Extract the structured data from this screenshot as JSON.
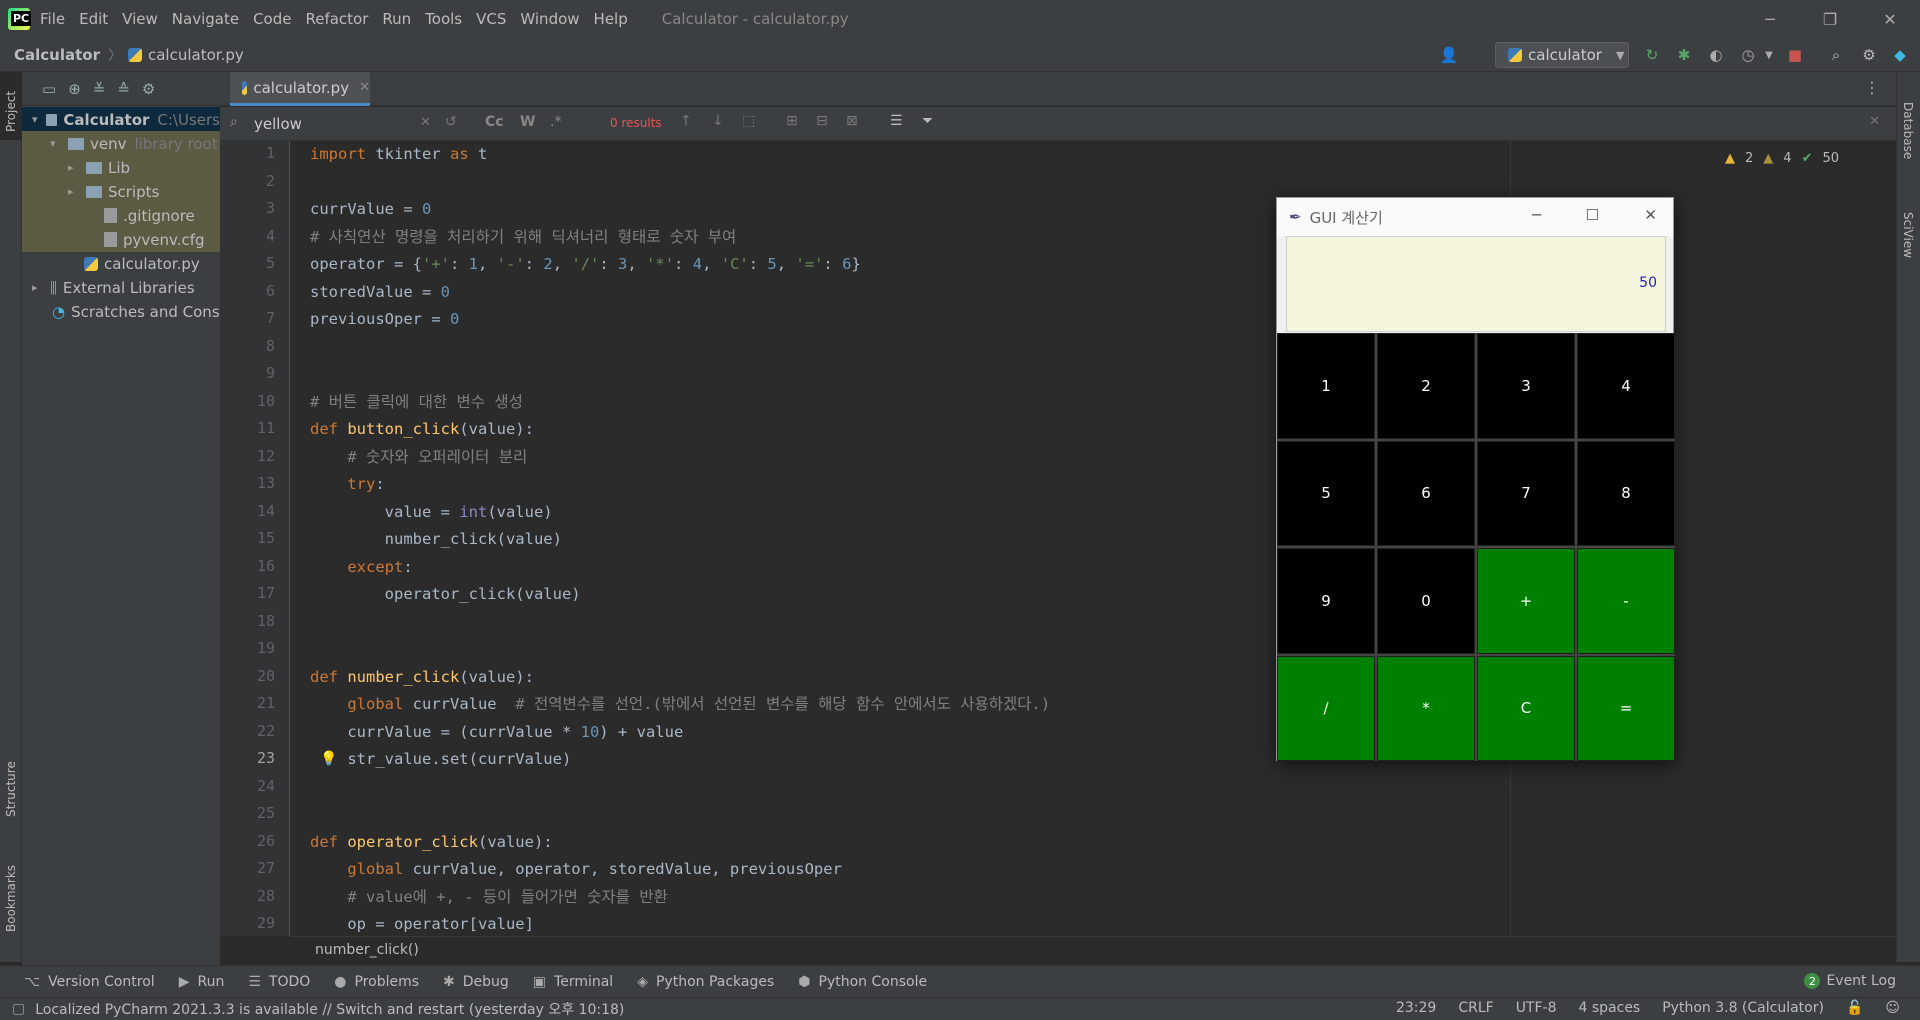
{
  "window": {
    "title": "Calculator - calculator.py",
    "menu": [
      "File",
      "Edit",
      "View",
      "Navigate",
      "Code",
      "Refactor",
      "Run",
      "Tools",
      "VCS",
      "Window",
      "Help"
    ]
  },
  "navbar": {
    "project": "Calculator",
    "file": "calculator.py",
    "run_config": "calculator"
  },
  "side_stripes": {
    "left_top": "Project",
    "left_structure": "Structure",
    "left_bookmarks": "Bookmarks",
    "right_database": "Database",
    "right_sciview": "SciView"
  },
  "project_tree": [
    {
      "label": "Calculator",
      "hint": "C:\\Users",
      "icon": "folder-icon",
      "arrow": "▾"
    },
    {
      "label": "venv",
      "hint": "library root",
      "icon": "folder-icon",
      "arrow": "▾"
    },
    {
      "label": "Lib",
      "hint": "",
      "icon": "folder-icon",
      "arrow": "▸"
    },
    {
      "label": "Scripts",
      "hint": "",
      "icon": "folder-icon",
      "arrow": "▸"
    },
    {
      "label": ".gitignore",
      "hint": "",
      "icon": "file-icon",
      "arrow": ""
    },
    {
      "label": "pyvenv.cfg",
      "hint": "",
      "icon": "file-icon",
      "arrow": ""
    },
    {
      "label": "calculator.py",
      "hint": "",
      "icon": "python-file-icon",
      "arrow": ""
    },
    {
      "label": "External Libraries",
      "hint": "",
      "icon": "library-icon",
      "arrow": "▸"
    },
    {
      "label": "Scratches and Consoles",
      "hint": "",
      "icon": "scratch-icon",
      "arrow": ""
    }
  ],
  "editor": {
    "tab": "calculator.py",
    "search_value": "yellow",
    "search_results": "0 results",
    "inspections": {
      "warnings": "2",
      "weak_warnings": "4",
      "ok": "50"
    },
    "breadcrumb": "number_click()",
    "current_line": "23"
  },
  "code_lines": [
    [
      {
        "t": "import ",
        "c": "kw"
      },
      {
        "t": "tkinter ",
        "c": ""
      },
      {
        "t": "as ",
        "c": "kw"
      },
      {
        "t": "t",
        "c": ""
      }
    ],
    [],
    [
      {
        "t": "currValue = ",
        "c": ""
      },
      {
        "t": "0",
        "c": "num"
      }
    ],
    [
      {
        "t": "# 사칙연산 명령을 처리하기 위해 딕셔너리 형태로 숫자 부여",
        "c": "cm"
      }
    ],
    [
      {
        "t": "operator = {",
        "c": ""
      },
      {
        "t": "'+'",
        "c": "str"
      },
      {
        "t": ": ",
        "c": ""
      },
      {
        "t": "1",
        "c": "num"
      },
      {
        "t": ", ",
        "c": ""
      },
      {
        "t": "'-'",
        "c": "str"
      },
      {
        "t": ": ",
        "c": ""
      },
      {
        "t": "2",
        "c": "num"
      },
      {
        "t": ", ",
        "c": ""
      },
      {
        "t": "'/'",
        "c": "str"
      },
      {
        "t": ": ",
        "c": ""
      },
      {
        "t": "3",
        "c": "num"
      },
      {
        "t": ", ",
        "c": ""
      },
      {
        "t": "'*'",
        "c": "str"
      },
      {
        "t": ": ",
        "c": ""
      },
      {
        "t": "4",
        "c": "num"
      },
      {
        "t": ", ",
        "c": ""
      },
      {
        "t": "'C'",
        "c": "str"
      },
      {
        "t": ": ",
        "c": ""
      },
      {
        "t": "5",
        "c": "num"
      },
      {
        "t": ", ",
        "c": ""
      },
      {
        "t": "'='",
        "c": "str"
      },
      {
        "t": ": ",
        "c": ""
      },
      {
        "t": "6",
        "c": "num"
      },
      {
        "t": "}",
        "c": ""
      }
    ],
    [
      {
        "t": "storedValue = ",
        "c": ""
      },
      {
        "t": "0",
        "c": "num"
      }
    ],
    [
      {
        "t": "previousOper = ",
        "c": ""
      },
      {
        "t": "0",
        "c": "num"
      }
    ],
    [],
    [],
    [
      {
        "t": "# 버튼 클릭에 대한 변수 생성",
        "c": "cm"
      }
    ],
    [
      {
        "t": "def ",
        "c": "kw"
      },
      {
        "t": "button_click",
        "c": "fn"
      },
      {
        "t": "(value):",
        "c": ""
      }
    ],
    [
      {
        "t": "    # 숫자와 오퍼레이터 분리",
        "c": "cm"
      }
    ],
    [
      {
        "t": "    ",
        "c": ""
      },
      {
        "t": "try",
        "c": "kw"
      },
      {
        "t": ":",
        "c": ""
      }
    ],
    [
      {
        "t": "        value = ",
        "c": ""
      },
      {
        "t": "int",
        "c": "bi"
      },
      {
        "t": "(value)",
        "c": ""
      }
    ],
    [
      {
        "t": "        number_click(value)",
        "c": ""
      }
    ],
    [
      {
        "t": "    ",
        "c": ""
      },
      {
        "t": "except",
        "c": "kw"
      },
      {
        "t": ":",
        "c": ""
      }
    ],
    [
      {
        "t": "        operator_click(value)",
        "c": ""
      }
    ],
    [],
    [],
    [
      {
        "t": "def ",
        "c": "kw"
      },
      {
        "t": "number_click",
        "c": "fn"
      },
      {
        "t": "(value):",
        "c": ""
      }
    ],
    [
      {
        "t": "    ",
        "c": ""
      },
      {
        "t": "global ",
        "c": "kw"
      },
      {
        "t": "currValue  ",
        "c": ""
      },
      {
        "t": "# 전역변수를 선언.(밖에서 선언된 변수를 해당 함수 안에서도 사용하겠다.)",
        "c": "cm"
      }
    ],
    [
      {
        "t": "    currValue = (currValue * ",
        "c": ""
      },
      {
        "t": "10",
        "c": "num"
      },
      {
        "t": ") + value",
        "c": ""
      }
    ],
    [
      {
        "t": "    str_value.set(currValue)",
        "c": ""
      }
    ],
    [],
    [],
    [
      {
        "t": "def ",
        "c": "kw"
      },
      {
        "t": "operator_click",
        "c": "fn"
      },
      {
        "t": "(value):",
        "c": ""
      }
    ],
    [
      {
        "t": "    ",
        "c": ""
      },
      {
        "t": "global ",
        "c": "kw"
      },
      {
        "t": "currValue, operator, storedValue, previousOper",
        "c": ""
      }
    ],
    [
      {
        "t": "    # value에 +, - 등이 들어가면 숫자를 반환",
        "c": "cm"
      }
    ],
    [
      {
        "t": "    op = operator[value]",
        "c": ""
      }
    ]
  ],
  "calc_window": {
    "title": "GUI 계산기",
    "display_value": "50",
    "keys": [
      {
        "label": "1",
        "style": "blk"
      },
      {
        "label": "2",
        "style": "blk"
      },
      {
        "label": "3",
        "style": "blk"
      },
      {
        "label": "4",
        "style": "blk"
      },
      {
        "label": "5",
        "style": "blk"
      },
      {
        "label": "6",
        "style": "blk"
      },
      {
        "label": "7",
        "style": "blk"
      },
      {
        "label": "8",
        "style": "blk"
      },
      {
        "label": "9",
        "style": "blk"
      },
      {
        "label": "0",
        "style": "blk"
      },
      {
        "label": "+",
        "style": "grn"
      },
      {
        "label": "-",
        "style": "grn"
      },
      {
        "label": "/",
        "style": "grn"
      },
      {
        "label": "*",
        "style": "grn"
      },
      {
        "label": "C",
        "style": "grn"
      },
      {
        "label": "=",
        "style": "grn"
      }
    ]
  },
  "tool_windows": [
    {
      "label": "Version Control",
      "icon": "⌥"
    },
    {
      "label": "Run",
      "icon": "▶"
    },
    {
      "label": "TODO",
      "icon": "☰"
    },
    {
      "label": "Problems",
      "icon": "●"
    },
    {
      "label": "Debug",
      "icon": "✱"
    },
    {
      "label": "Terminal",
      "icon": "▣"
    },
    {
      "label": "Python Packages",
      "icon": "◈"
    },
    {
      "label": "Python Console",
      "icon": "⬢"
    }
  ],
  "event_log": {
    "count": "2",
    "label": "Event Log"
  },
  "status": {
    "message": "Localized PyCharm 2021.3.3 is available // Switch and restart (yesterday 오후 10:18)",
    "position": "23:29",
    "line_sep": "CRLF",
    "encoding": "UTF-8",
    "indent": "4 spaces",
    "interpreter": "Python 3.8 (Calculator)"
  },
  "colors": {
    "accent": "#4a88c7",
    "calc_green": "#008000",
    "display_bg": "#f5f4dc",
    "display_text": "#2222cc"
  }
}
